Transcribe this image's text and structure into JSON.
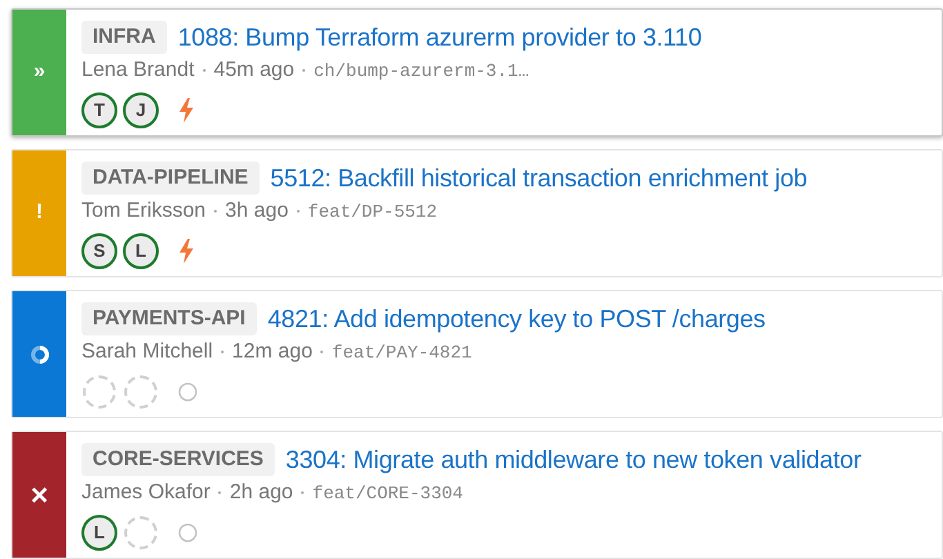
{
  "pull_requests": [
    {
      "status": {
        "kind": "queued",
        "glyph": "»"
      },
      "selected": true,
      "repo": "INFRA",
      "title": "1088: Bump Terraform azurerm provider to 3.110",
      "author": "Lena Brandt",
      "age": "45m ago",
      "branch": "ch/bump-azurerm-3.1…",
      "reviewers": [
        {
          "kind": "approved",
          "initials": "T"
        },
        {
          "kind": "approved",
          "initials": "J"
        }
      ],
      "checks": {
        "kind": "bolt"
      }
    },
    {
      "status": {
        "kind": "warning",
        "glyph": "!"
      },
      "selected": false,
      "repo": "DATA-PIPELINE",
      "title": "5512: Backfill historical transaction enrichment job",
      "author": "Tom Eriksson",
      "age": "3h ago",
      "branch": "feat/DP-5512",
      "reviewers": [
        {
          "kind": "approved",
          "initials": "S"
        },
        {
          "kind": "approved",
          "initials": "L"
        }
      ],
      "checks": {
        "kind": "bolt"
      }
    },
    {
      "status": {
        "kind": "running"
      },
      "selected": false,
      "repo": "PAYMENTS-API",
      "title": "4821: Add idempotency key to POST /charges",
      "author": "Sarah Mitchell",
      "age": "12m ago",
      "branch": "feat/PAY-4821",
      "reviewers": [
        {
          "kind": "pending"
        },
        {
          "kind": "pending"
        }
      ],
      "checks": {
        "kind": "circle"
      }
    },
    {
      "status": {
        "kind": "failed",
        "glyph": "×"
      },
      "selected": false,
      "repo": "CORE-SERVICES",
      "title": "3304: Migrate auth middleware to new token validator",
      "author": "James Okafor",
      "age": "2h ago",
      "branch": "feat/CORE-3304",
      "reviewers": [
        {
          "kind": "approved",
          "initials": "L"
        },
        {
          "kind": "pending"
        }
      ],
      "checks": {
        "kind": "circle"
      }
    }
  ]
}
